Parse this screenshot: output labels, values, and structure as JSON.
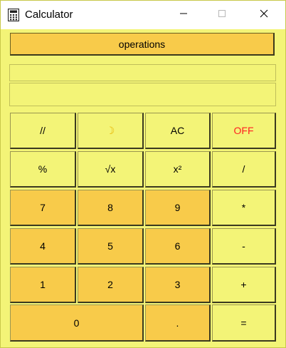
{
  "window": {
    "title": "Calculator",
    "icon": "calculator-icon",
    "controls": {
      "minimize": "minimize-icon",
      "maximize": "maximize-icon",
      "close": "close-icon"
    }
  },
  "operations_button": {
    "label": "operations"
  },
  "displays": {
    "expression": "",
    "result": ""
  },
  "keys": {
    "floor_div": "//",
    "theme": "☽",
    "clear": "AC",
    "off": "OFF",
    "percent": "%",
    "sqrt": "√x",
    "square": "x²",
    "divide": "/",
    "seven": "7",
    "eight": "8",
    "nine": "9",
    "multiply": "*",
    "four": "4",
    "five": "5",
    "six": "6",
    "minus": "-",
    "one": "1",
    "two": "2",
    "three": "3",
    "plus": "+",
    "zero": "0",
    "dot": ".",
    "equals": "="
  },
  "colors": {
    "background": "#f3f477",
    "key_dark": "#f8cb4a",
    "off_text": "#ff2020",
    "theme_icon": "#e8b400"
  }
}
